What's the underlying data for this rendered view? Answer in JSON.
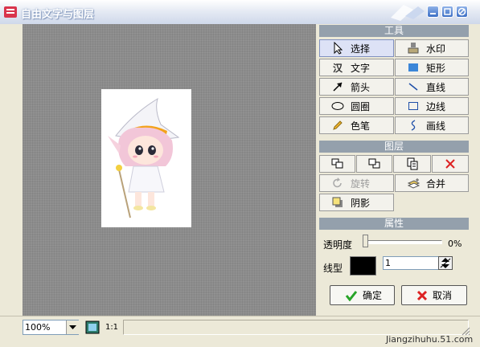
{
  "window": {
    "title": "自由文字与图层"
  },
  "tools": {
    "header": "工具",
    "items": [
      {
        "label": "选择",
        "icon": "cursor-icon"
      },
      {
        "label": "水印",
        "icon": "stamp-icon"
      },
      {
        "label": "文字",
        "icon": "text-icon"
      },
      {
        "label": "矩形",
        "icon": "rectangle-fill-icon"
      },
      {
        "label": "箭头",
        "icon": "arrow-icon"
      },
      {
        "label": "直线",
        "icon": "line-icon"
      },
      {
        "label": "圆圈",
        "icon": "ellipse-icon"
      },
      {
        "label": "边线",
        "icon": "border-icon"
      },
      {
        "label": "色笔",
        "icon": "pencil-icon"
      },
      {
        "label": "画线",
        "icon": "curve-icon"
      }
    ]
  },
  "layers": {
    "header": "图层",
    "rotate_label": "旋转",
    "merge_label": "合并",
    "shadow_label": "阴影"
  },
  "properties": {
    "header": "属性",
    "opacity_label": "透明度",
    "opacity_value": "0%",
    "linetype_label": "线型",
    "line_width": "1",
    "color": "#000000"
  },
  "dialog": {
    "ok_label": "确定",
    "cancel_label": "取消"
  },
  "statusbar": {
    "zoom": "100%",
    "actual_size": "1:1"
  },
  "watermark": "Jiangzihuhu.51.com"
}
